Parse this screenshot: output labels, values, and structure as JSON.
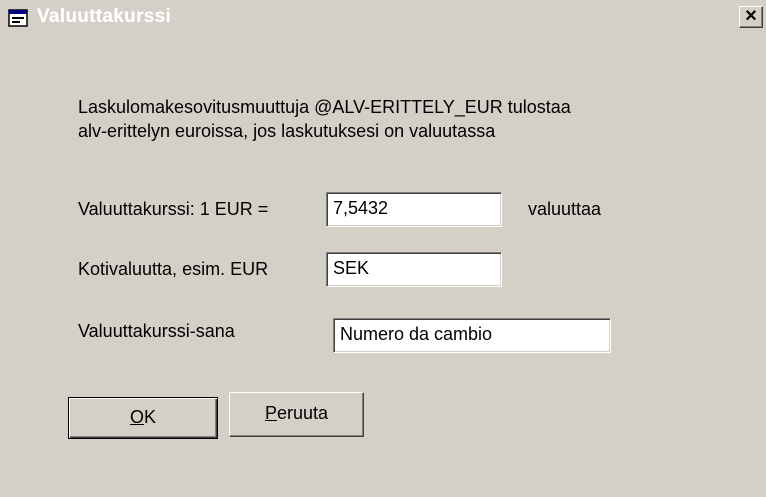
{
  "window": {
    "title": "Valuuttakurssi",
    "close_label": "×"
  },
  "description": {
    "line1": "Laskulomakesovitusmuuttuja @ALV-ERITTELY_EUR tulostaa",
    "line2": "alv-erittelyn euroissa, jos laskutuksesi on valuutassa"
  },
  "fields": {
    "exchange_rate": {
      "label": "Valuuttakurssi: 1 EUR =",
      "value": "7,5432",
      "suffix": "valuuttaa"
    },
    "home_currency": {
      "label": "Kotivaluutta, esim. EUR",
      "value": "SEK"
    },
    "rate_word": {
      "label": "Valuuttakurssi-sana",
      "value": "Numero da cambio"
    }
  },
  "buttons": {
    "ok": {
      "mnemonic": "O",
      "rest": "K"
    },
    "cancel": {
      "mnemonic": "P",
      "rest": "eruuta"
    }
  }
}
